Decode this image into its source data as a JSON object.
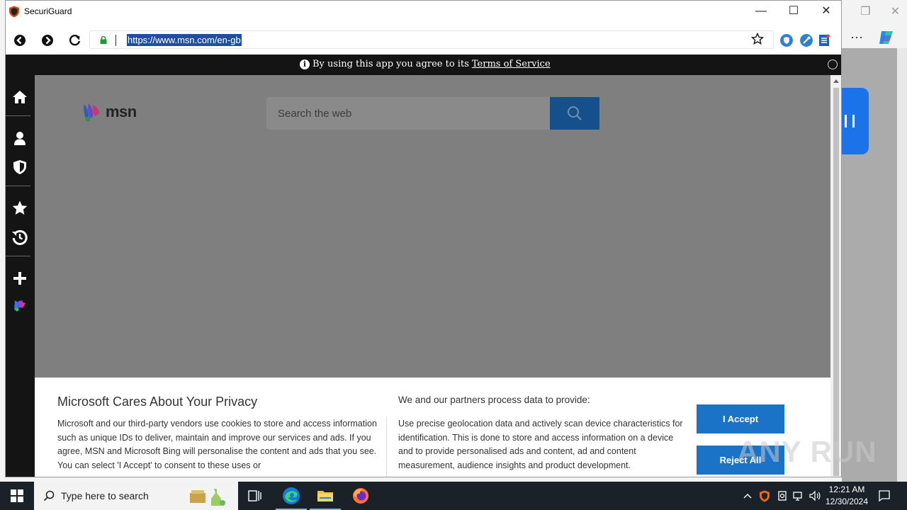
{
  "app": {
    "title": "SecuriGuard"
  },
  "address_bar": {
    "url": "https://www.msn.com/en-gb"
  },
  "tos_bar": {
    "prefix": "By using this app you agree to its",
    "link": "Terms of Service"
  },
  "msn": {
    "logo_text": "msn",
    "search_placeholder": "Search the web"
  },
  "privacy": {
    "title": "Microsoft Cares About Your Privacy",
    "body": "Microsoft and our third-party vendors use cookies to store and access information such as unique IDs to deliver, maintain and improve our services and ads. If you agree, MSN and Microsoft Bing will personalise the content and ads that you see. You can select 'I Accept' to consent to these uses or",
    "right_title": "We and our partners process data to provide:",
    "right_body": "Use precise geolocation data and actively scan device characteristics for identification. This is done to store and access information on a device and to provide personalised ads and content, ad and content measurement, audience insights and product development.",
    "accept_label": "I Accept",
    "reject_label": "Reject All"
  },
  "watermark": "ANY RUN",
  "taskbar": {
    "search_placeholder": "Type here to search",
    "time": "12:21 AM",
    "date": "12/30/2024"
  },
  "colors": {
    "accent_blue": "#1a73c6",
    "search_button": "#15508a",
    "sidebar_bg": "#141414",
    "taskbar_bg": "#1b2129"
  }
}
